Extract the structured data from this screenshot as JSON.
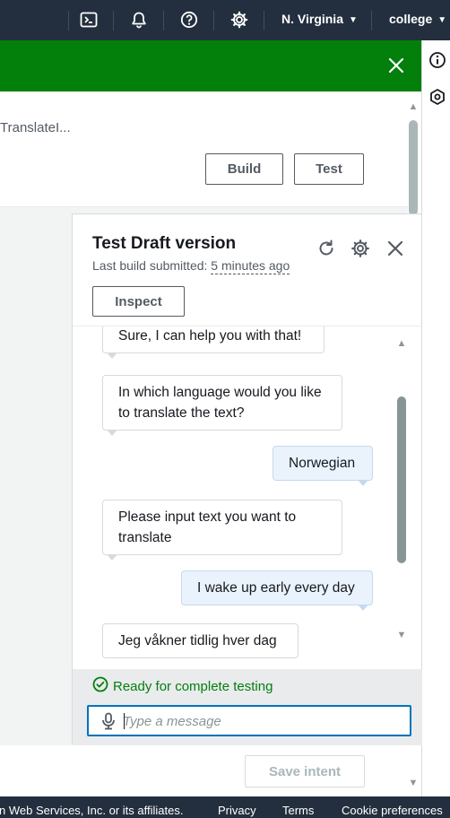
{
  "topbar": {
    "region": "N. Virginia",
    "account": "college",
    "icons": [
      "terminal-icon",
      "bell-icon",
      "help-icon",
      "gear-icon"
    ]
  },
  "truncated_text": "TranslateI...",
  "buttons": {
    "build": "Build",
    "test": "Test",
    "save_intent": "Save intent"
  },
  "test_panel": {
    "title": "Test Draft version",
    "subtitle_prefix": "Last build submitted:",
    "subtitle_time": "5 minutes ago",
    "inspect_label": "Inspect",
    "status": "Ready for complete testing",
    "input_placeholder": "Type a message",
    "messages": [
      {
        "from": "bot",
        "text": "Sure, I can help you with that!"
      },
      {
        "from": "bot",
        "text": "In which language would you like to translate the text?"
      },
      {
        "from": "user",
        "text": "Norwegian"
      },
      {
        "from": "bot",
        "text": "Please input text you want to translate"
      },
      {
        "from": "user",
        "text": "I wake up early every day"
      },
      {
        "from": "bot",
        "text": "Jeg våkner tidlig hver dag"
      }
    ]
  },
  "footer": {
    "copyright": "n Web Services, Inc. or its affiliates.",
    "privacy": "Privacy",
    "terms": "Terms",
    "cookies": "Cookie preferences"
  },
  "colors": {
    "topbar": "#232f3e",
    "flash_success": "#037f0c",
    "accent_blue": "#0073bb",
    "user_bubble": "#eaf3fc"
  }
}
